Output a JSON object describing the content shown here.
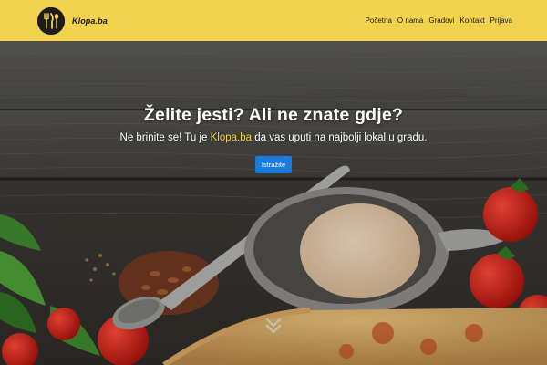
{
  "header": {
    "brand_name": "Klopa.ba",
    "nav": [
      {
        "label": "Početna"
      },
      {
        "label": "O nama"
      },
      {
        "label": "Gradovi"
      },
      {
        "label": "Kontakt"
      },
      {
        "label": "Prijava"
      }
    ]
  },
  "hero": {
    "title": "Želite jesti? Ali ne znate gdje?",
    "subtitle_before": "Ne brinite se! Tu je ",
    "subtitle_brand": "Klopa.ba",
    "subtitle_after": " da vas uputi na najbolji lokal u gradu.",
    "cta_label": "Istražite"
  },
  "icons": {
    "logo": "fork-knife-spoon-icon",
    "scroll": "double-chevron-down-icon"
  },
  "colors": {
    "header_bg": "#f2d34e",
    "brand_highlight": "#f2d34e",
    "cta_bg": "#1a7bdf"
  }
}
